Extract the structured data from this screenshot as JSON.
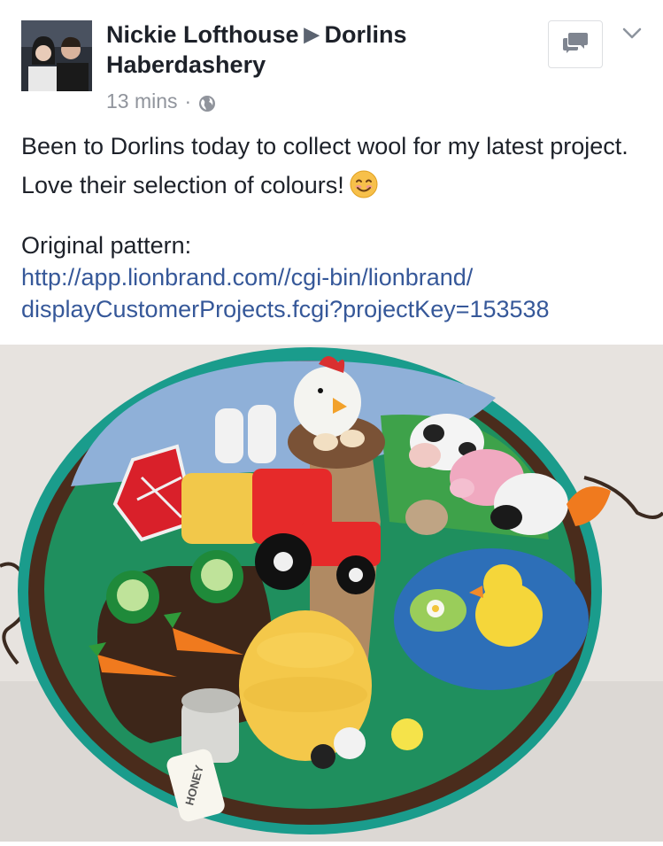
{
  "post": {
    "author": "Nickie Lofthouse",
    "arrow": "▶",
    "target_page": "Dorlins Haberdashery",
    "time": "13 mins",
    "separator": "·",
    "privacy_icon": "globe-icon",
    "body_line1": "Been to Dorlins today to collect wool for my latest project. Love their selection of colours!",
    "emoji": "smiling-face-emoji",
    "pattern_label": "Original pattern:",
    "link_line1": "http://app.lionbrand.com//cgi-bin/lionbrand/",
    "link_line2": "displayCustomerProjects.fcgi?projectKey=153538",
    "photo_text": "HONEY"
  },
  "header": {
    "comment_icon": "comment-icon",
    "menu_icon": "chevron-down-icon"
  },
  "colors": {
    "text": "#1d2129",
    "meta": "#90949c",
    "link": "#365899",
    "border": "#dddfe2"
  }
}
